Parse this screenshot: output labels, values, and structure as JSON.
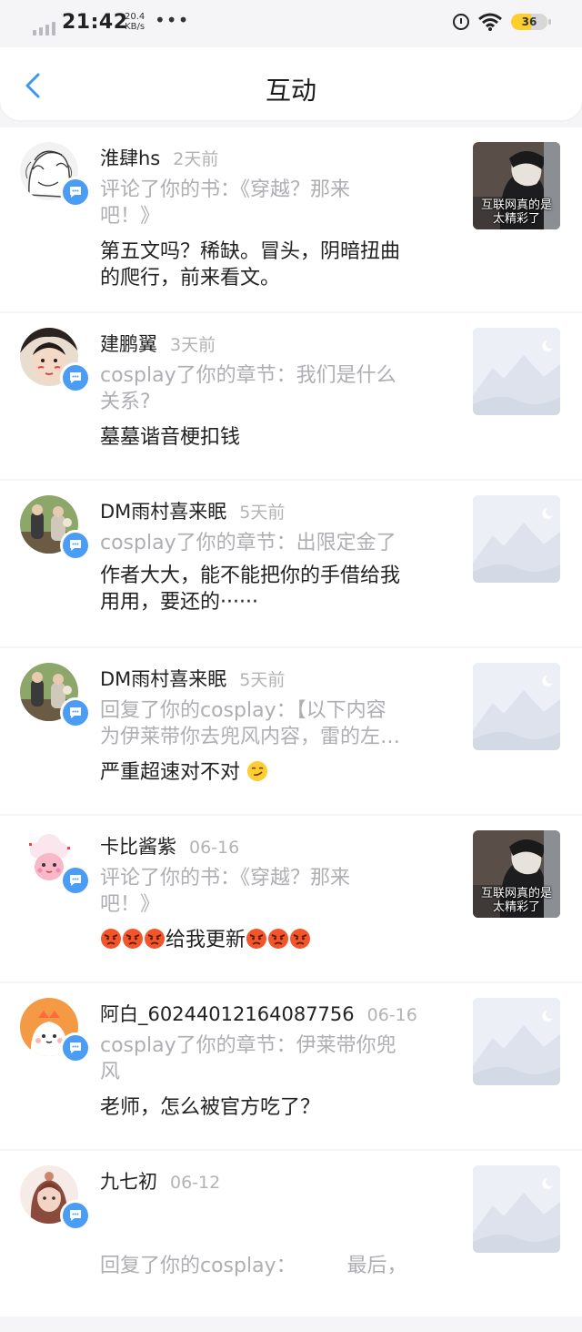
{
  "status_bar": {
    "time": "21:42",
    "speed_value": "20.4",
    "speed_unit": "KB/s",
    "dots": "•••",
    "battery": "36"
  },
  "header": {
    "title": "互动"
  },
  "items": [
    {
      "user": "淮肆hs",
      "time": "2天前",
      "action_line1": "评论了你的书：《穿越？那来",
      "action_line2": "吧！》",
      "content_line1": "第五文吗？稀缺。冒头，阴暗扭曲",
      "content_line2": "的爬行，前来看文。",
      "thumb_caption_line1": "互联网真的是",
      "thumb_caption_line2": "太精彩了"
    },
    {
      "user": "建鹏翼",
      "time": "3天前",
      "action_line1": "cosplay了你的章节：我们是什么",
      "action_line2": "关系?",
      "content_line1": "墓墓谐音梗扣钱"
    },
    {
      "user": "DM雨村喜来眠",
      "time": "5天前",
      "action_line1": "cosplay了你的章节：出限定金了",
      "content_line1": "作者大大，能不能把你的手借给我",
      "content_line2": "用用，要还的······"
    },
    {
      "user": "DM雨村喜来眠",
      "time": "5天前",
      "action_line1": "回复了你的cosplay：【以下内容",
      "action_line2": "为伊莱带你去兜风内容，雷的左…",
      "content_line1": "严重超速对不对"
    },
    {
      "user": "卡比酱紫",
      "time": "06-16",
      "action_line1": "评论了你的书：《穿越？那来",
      "action_line2": "吧！》",
      "content_line1": "给我更新",
      "thumb_caption_line1": "互联网真的是",
      "thumb_caption_line2": "太精彩了"
    },
    {
      "user": "阿白_60244012164087756",
      "time": "06-16",
      "action_line1": "cosplay了你的章节：伊莱带你兜",
      "action_line2": "风",
      "content_line1": "老师，怎么被官方吃了？"
    },
    {
      "user": "九七初",
      "time": "06-12",
      "action_line1": "回复了你的cosplay：        最后，"
    }
  ],
  "icons": {
    "back": "chevron-left-icon",
    "badge": "comment-icon",
    "placeholder": "mountain-image-icon"
  },
  "colors": {
    "accent": "#4a9cf5",
    "muted_text": "#aeaeb3",
    "battery": "#ffcd2e"
  }
}
